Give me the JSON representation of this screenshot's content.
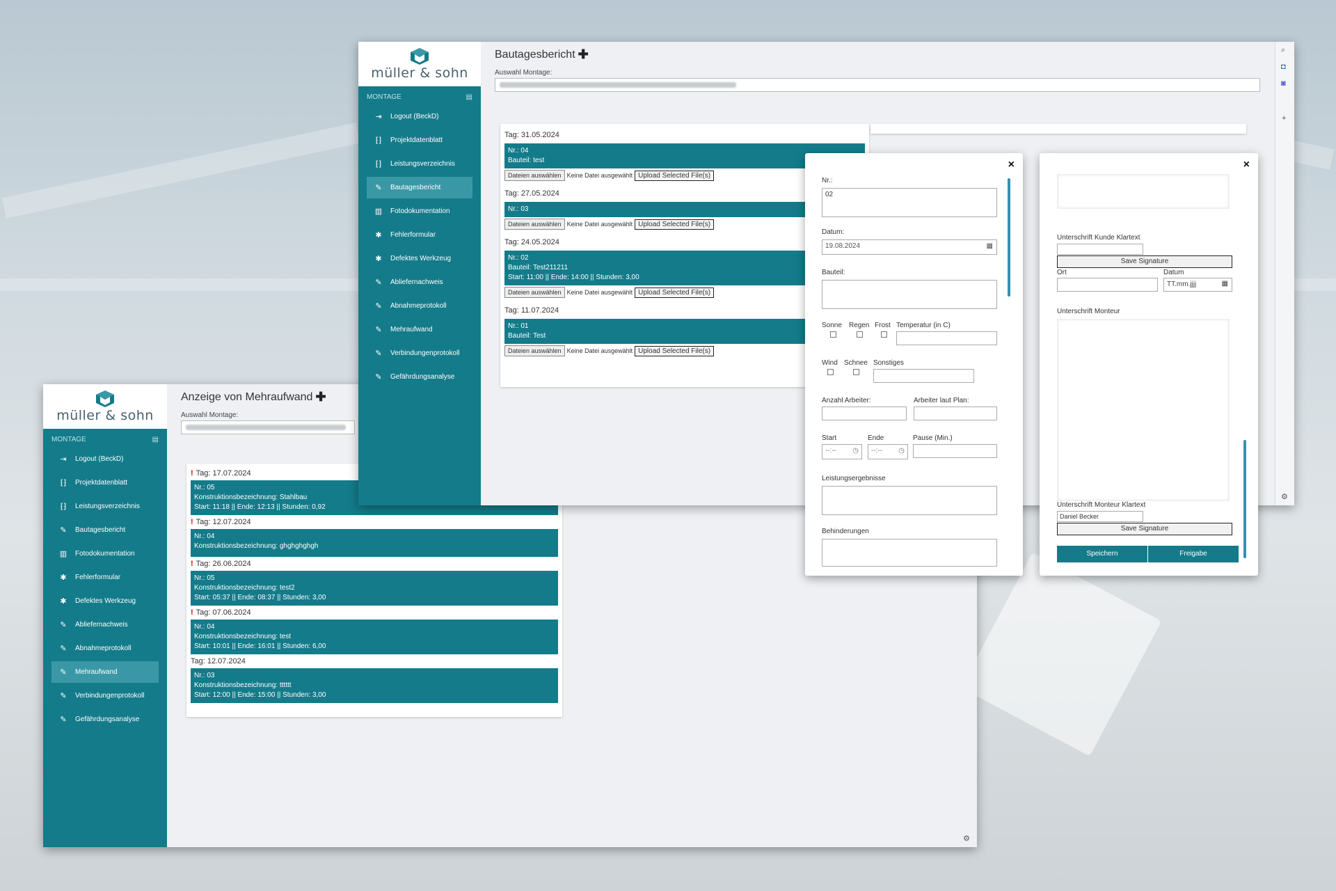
{
  "brand": {
    "name": "müller & sohn"
  },
  "sidebar": {
    "section": "MONTAGE",
    "items": [
      {
        "label": "Logout (BeckD)",
        "icon": "logout-icon"
      },
      {
        "label": "Projektdatenblatt",
        "icon": "bracket-icon"
      },
      {
        "label": "Leistungsverzeichnis",
        "icon": "bracket-icon"
      },
      {
        "label": "Bautagesbericht",
        "icon": "pencil-icon"
      },
      {
        "label": "Fotodokumentation",
        "icon": "book-icon"
      },
      {
        "label": "Fehlerformular",
        "icon": "bug-icon"
      },
      {
        "label": "Defektes Werkzeug",
        "icon": "bug-icon"
      },
      {
        "label": "Abliefernachweis",
        "icon": "pencil-icon"
      },
      {
        "label": "Abnahmeprotokoll",
        "icon": "pencil-icon"
      },
      {
        "label": "Mehraufwand",
        "icon": "pencil-icon"
      },
      {
        "label": "Verbindungenprotokoll",
        "icon": "pencil-icon"
      },
      {
        "label": "Gefährdungsanalyse",
        "icon": "pencil-icon"
      }
    ]
  },
  "mehraufwand": {
    "title": "Anzeige von Mehraufwand",
    "select_label": "Auswahl Montage:",
    "groups": [
      {
        "day": "Tag: 17.07.2024",
        "nr": "Nr.: 05",
        "bez": "Konstruktionsbezeichnung: Stahlbau",
        "time": "Start: 11:18 || Ende: 12:13 || Stunden: 0,92"
      },
      {
        "day": "Tag: 12.07.2024",
        "nr": "Nr.: 04",
        "bez": "Konstruktionsbezeichnung: ghghghghgh",
        "time": ""
      },
      {
        "day": "Tag: 26.06.2024",
        "nr": "Nr.: 05",
        "bez": "Konstruktionsbezeichnung: test2",
        "time": "Start: 05:37 || Ende: 08:37 || Stunden: 3,00"
      },
      {
        "day": "Tag: 07.06.2024",
        "nr": "Nr.: 04",
        "bez": "Konstruktionsbezeichnung: test",
        "time": "Start: 10:01 || Ende: 16:01 || Stunden: 6,00"
      },
      {
        "day": "Tag: 12.07.2024",
        "nr": "Nr.: 03",
        "bez": "Konstruktionsbezeichnung: tttttt",
        "time": "Start: 12:00 || Ende: 15:00 || Stunden: 3,00"
      }
    ]
  },
  "bautages": {
    "title": "Bautagesbericht",
    "select_label": "Auswahl Montage:",
    "file_btn": "Dateien auswählen",
    "no_file": "Keine Datei ausgewählt",
    "upload_btn": "Upload Selected File(s)",
    "groups": [
      {
        "day": "Tag: 31.05.2024",
        "nr": "Nr.: 04",
        "line2": "Bauteil: test",
        "line3": ""
      },
      {
        "day": "Tag: 27.05.2024",
        "nr": "Nr.: 03",
        "line2": "",
        "line3": ""
      },
      {
        "day": "Tag: 24.05.2024",
        "nr": "Nr.: 02",
        "line2": "Bauteil: Test211211",
        "line3": "Start: 11:00 || Ende: 14:00 || Stunden: 3,00"
      },
      {
        "day": "Tag: 11.07.2024",
        "nr": "Nr.: 01",
        "line2": "Bauteil: Test",
        "line3": ""
      }
    ]
  },
  "form": {
    "close": "×",
    "nr_label": "Nr.:",
    "nr_value": "02",
    "datum_label": "Datum:",
    "datum_value": "19.08.2024",
    "bauteil_label": "Bauteil:",
    "w1": "Sonne",
    "w2": "Regen",
    "w3": "Frost",
    "temp_label": "Temperatur (in C)",
    "w4": "Wind",
    "w5": "Schnee",
    "sonstiges_label": "Sonstiges",
    "arbeiter_label": "Anzahl Arbeiter:",
    "plan_label": "Arbeiter laut Plan:",
    "start_label": "Start",
    "ende_label": "Ende",
    "pause_label": "Pause (Min.)",
    "time_placeholder": "--:--",
    "leistung_label": "Leistungsergebnisse",
    "behind_label": "Behinderungen"
  },
  "signature": {
    "close": "×",
    "kunde_label": "Unterschrift Kunde Klartext",
    "save_btn": "Save Signature",
    "ort_label": "Ort",
    "datum_label": "Datum",
    "datum_placeholder": "TT.mm.jjjj",
    "monteur_label": "Unterschrift Monteur",
    "monteur_klartext_label": "Unterschrift Monteur Klartext",
    "monteur_name": "Daniel Becker",
    "speichern": "Speichern",
    "freigabe": "Freigabe"
  }
}
